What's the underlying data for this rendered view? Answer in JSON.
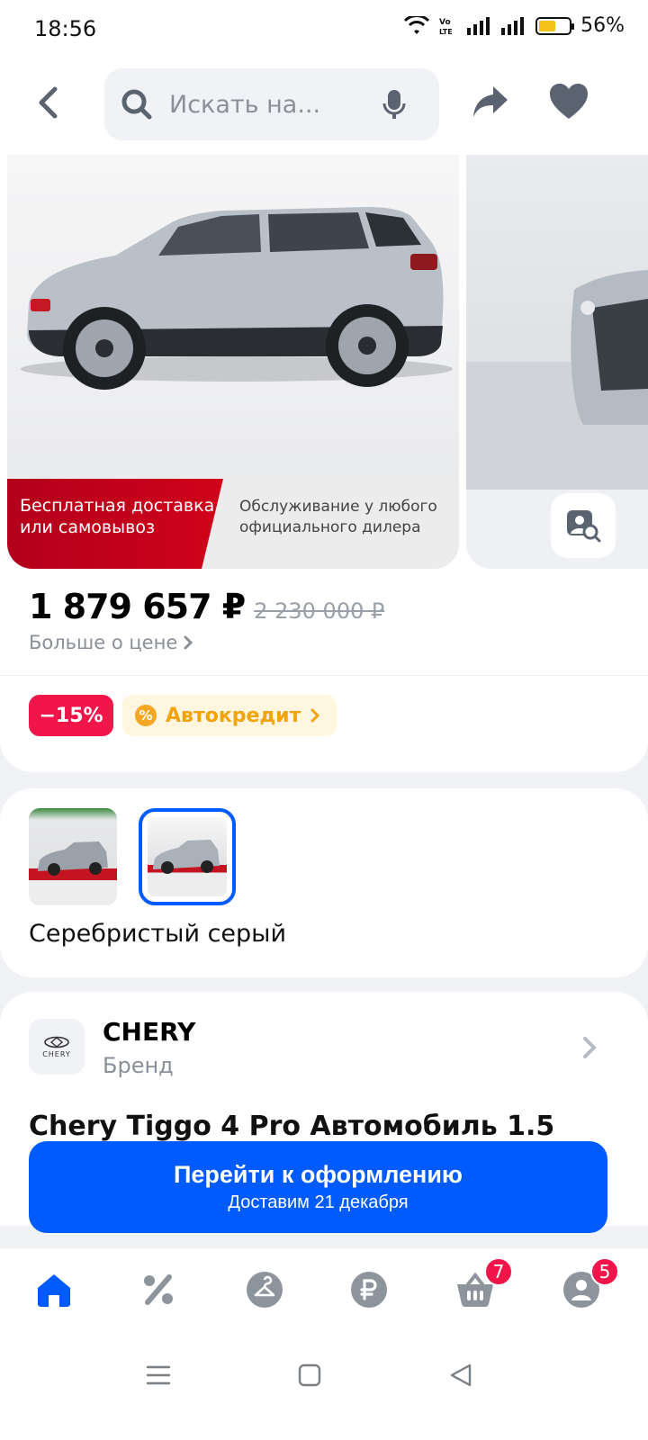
{
  "status_bar": {
    "time": "18:56",
    "battery_percent": "56%",
    "battery_level": 0.56
  },
  "search": {
    "placeholder": "Искать на..."
  },
  "gallery": {
    "banner_left": "Бесплатная доставка\nили самовывоз",
    "banner_right": "Обслуживание у любого\nофициального дилера"
  },
  "price": {
    "current": "1 879 657 ₽",
    "old": "2 230 000 ₽",
    "more_label": "Больше о цене"
  },
  "badges": {
    "discount": "−15%",
    "credit": "Автокредит"
  },
  "color": {
    "name": "Серебристый серый"
  },
  "brand": {
    "name": "CHERY",
    "label": "Бренд",
    "logo_text": "CHERY"
  },
  "product_title_peek": "Chery Tiggo 4 Pro Автомобиль 1.5",
  "checkout": {
    "title": "Перейти к оформлению",
    "subtitle": "Доставим 21 декабря"
  },
  "nav": {
    "cart_badge": "7",
    "profile_badge": "5"
  },
  "colors": {
    "accent": "#005bff",
    "discount": "#f1154a",
    "credit": "#f0a30a"
  }
}
